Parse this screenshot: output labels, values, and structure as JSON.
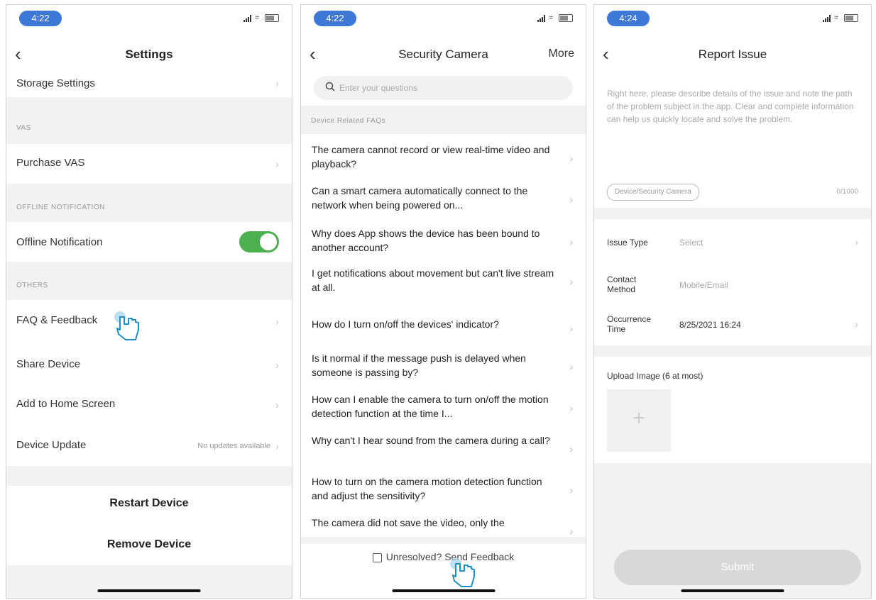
{
  "screen1": {
    "time": "4:22",
    "title": "Settings",
    "rows": {
      "storage": "Storage Settings",
      "purchase_vas": "Purchase VAS",
      "offline": "Offline Notification",
      "faq": "FAQ & Feedback",
      "share": "Share Device",
      "home": "Add to Home Screen",
      "update": "Device Update",
      "update_value": "No updates available"
    },
    "sections": {
      "vas": "VAS",
      "offline": "OFFLINE NOTIFICATION",
      "others": "OTHERS"
    },
    "offline_toggle_on": true,
    "restart": "Restart Device",
    "remove": "Remove Device"
  },
  "screen2": {
    "time": "4:22",
    "title": "Security Camera",
    "more": "More",
    "search_placeholder": "Enter your questions",
    "section": "Device Related FAQs",
    "faqs": [
      "The camera cannot record or view real-time video and playback?",
      "Can a smart camera automatically connect to the network when being powered on...",
      "Why does App shows the device has been bound to another account?",
      "I get notifications about movement but can't live stream at all.",
      "How do I turn on/off the devices' indicator?",
      "Is it normal if the message push is delayed when someone is passing by?",
      "How can I enable the camera to turn on/off the motion detection function at the time I...",
      "Why can't I hear sound from the camera during a call?",
      "How to turn on the camera motion detection function and adjust the sensitivity?",
      "The camera did not save the video, only the"
    ],
    "unresolved": "Unresolved?",
    "send_feedback": "Send Feedback"
  },
  "screen3": {
    "time": "4:24",
    "title": "Report Issue",
    "description_placeholder": "Right here, please describe details of the issue and note the path of the problem subject in the app. Clear and complete information can help us quickly locate and solve the problem.",
    "device_tag": "Device/Security Camera",
    "counter": "0/1000",
    "issue_type_label": "Issue Type",
    "issue_type_value": "Select",
    "contact_label": "Contact Method",
    "contact_value": "Mobile/Email",
    "occurrence_label": "Occurrence Time",
    "occurrence_value": "8/25/2021 16:24",
    "upload_label": "Upload Image (6 at most)",
    "submit": "Submit"
  },
  "colors": {
    "time_pill": "#3d78d6",
    "toggle_on": "#4caf50",
    "page_gray": "#f2f2f2",
    "submit_disabled": "#d8d8d8"
  },
  "icons": [
    "back-chevron-icon",
    "chevron-right-icon",
    "search-icon",
    "signal-icon",
    "wifi-icon",
    "battery-icon",
    "tap-hand-icon",
    "checkbox-icon",
    "plus-icon"
  ]
}
